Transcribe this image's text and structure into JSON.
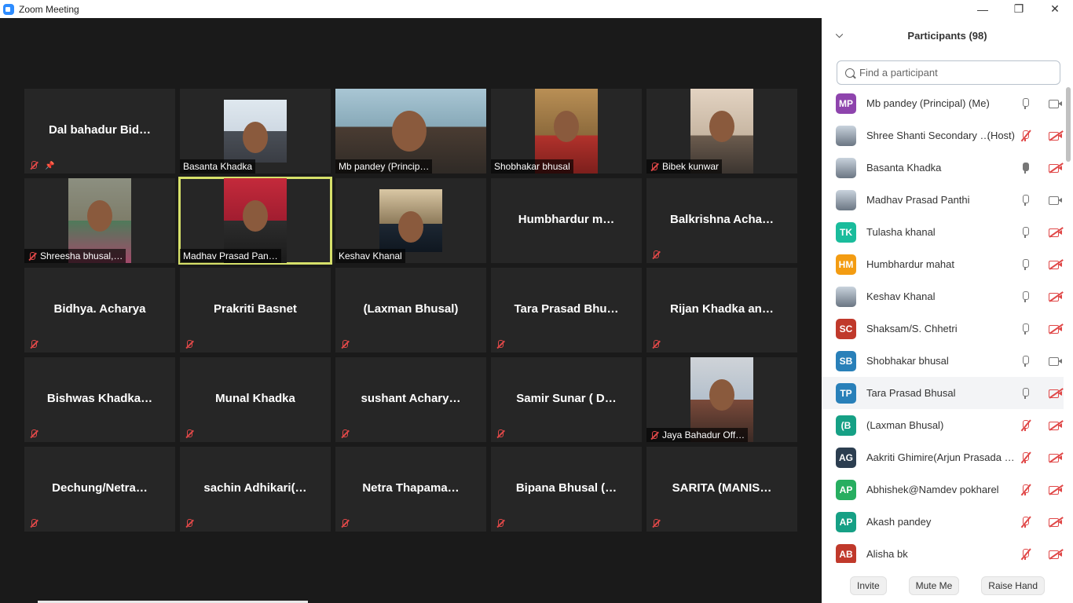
{
  "window": {
    "title": "Zoom Meeting",
    "minimize": "—",
    "restore": "❐",
    "close": "✕"
  },
  "tiles": [
    {
      "name": "Dal bahadur Bid…",
      "video": false,
      "muted": true,
      "pinned": true
    },
    {
      "name": "Basanta Khadka",
      "video": true,
      "photo": "ph-sky",
      "muted": false
    },
    {
      "name": "Mb pandey (Princip…",
      "video": true,
      "photo": "ph-room",
      "muted": false
    },
    {
      "name": "Shobhakar bhusal",
      "video": true,
      "photo": "ph-orange",
      "muted": false
    },
    {
      "name": "Bibek kunwar",
      "video": true,
      "photo": "ph-wall",
      "muted": true
    },
    {
      "name": "Shreesha bhusal,…",
      "video": true,
      "photo": "ph-family",
      "muted": true
    },
    {
      "name": "Madhav Prasad Pan…",
      "video": true,
      "photo": "ph-red",
      "muted": false,
      "active": true
    },
    {
      "name": "Keshav Khanal",
      "video": true,
      "photo": "ph-desk",
      "muted": false
    },
    {
      "name": "Humbhardur m…",
      "video": false,
      "muted": false
    },
    {
      "name": "Balkrishna Acha…",
      "video": false,
      "muted": true
    },
    {
      "name": "Bidhya. Acharya",
      "video": false,
      "muted": true
    },
    {
      "name": "Prakriti Basnet",
      "video": false,
      "muted": true
    },
    {
      "name": "(Laxman Bhusal)",
      "video": false,
      "muted": true
    },
    {
      "name": "Tara Prasad Bhu…",
      "video": false,
      "muted": true
    },
    {
      "name": "Rijan Khadka an…",
      "video": false,
      "muted": true
    },
    {
      "name": "Bishwas Khadka…",
      "video": false,
      "muted": true
    },
    {
      "name": "Munal Khadka",
      "video": false,
      "muted": true
    },
    {
      "name": "sushant Achary…",
      "video": false,
      "muted": true
    },
    {
      "name": "Samir Sunar ( D…",
      "video": false,
      "muted": true
    },
    {
      "name": "Jaya Bahadur Off…",
      "video": true,
      "photo": "ph-flag",
      "muted": true
    },
    {
      "name": "Dechung/Netra…",
      "video": false,
      "muted": true
    },
    {
      "name": "sachin Adhikari(…",
      "video": false,
      "muted": true
    },
    {
      "name": "Netra Thapama…",
      "video": false,
      "muted": true
    },
    {
      "name": "Bipana Bhusal (…",
      "video": false,
      "muted": true
    },
    {
      "name": "SARITA (MANIS…",
      "video": false,
      "muted": true
    }
  ],
  "participants": {
    "title": "Participants (98)",
    "search_placeholder": "Find a participant",
    "list": [
      {
        "initials": "MP",
        "color": "#8e44ad",
        "name": "Mb pandey (Principal) (Me)",
        "tag": "",
        "mic": "on",
        "cam": "on"
      },
      {
        "initials": "",
        "color": "",
        "photo": true,
        "name": "Shree Shanti Secondary …",
        "tag": "(Host)",
        "mic": "muted",
        "cam": "off"
      },
      {
        "initials": "",
        "color": "",
        "photo": true,
        "name": "Basanta Khadka",
        "tag": "",
        "mic": "speaking",
        "cam": "off"
      },
      {
        "initials": "",
        "color": "",
        "photo": true,
        "name": "Madhav Prasad Panthi",
        "tag": "",
        "mic": "on",
        "cam": "on"
      },
      {
        "initials": "TK",
        "color": "#1abc9c",
        "name": "Tulasha khanal",
        "tag": "",
        "mic": "on",
        "cam": "off"
      },
      {
        "initials": "HM",
        "color": "#f39c12",
        "name": "Humbhardur mahat",
        "tag": "",
        "mic": "on",
        "cam": "off"
      },
      {
        "initials": "",
        "color": "",
        "photo": true,
        "name": "Keshav Khanal",
        "tag": "",
        "mic": "on",
        "cam": "off"
      },
      {
        "initials": "SC",
        "color": "#c0392b",
        "name": "Shaksam/S. Chhetri",
        "tag": "",
        "mic": "on",
        "cam": "off"
      },
      {
        "initials": "SB",
        "color": "#2980b9",
        "name": "Shobhakar bhusal",
        "tag": "",
        "mic": "on",
        "cam": "on"
      },
      {
        "initials": "TP",
        "color": "#2980b9",
        "name": "Tara Prasad Bhusal",
        "tag": "",
        "mic": "on",
        "cam": "off",
        "hover": true
      },
      {
        "initials": "(B",
        "color": "#16a085",
        "name": "(Laxman Bhusal)",
        "tag": "",
        "mic": "muted",
        "cam": "off"
      },
      {
        "initials": "AG",
        "color": "#2c3e50",
        "name": "Aakriti Ghimire(Arjun Prasada G…",
        "tag": "",
        "mic": "muted",
        "cam": "off"
      },
      {
        "initials": "AP",
        "color": "#27ae60",
        "name": "Abhishek@Namdev pokharel",
        "tag": "",
        "mic": "muted",
        "cam": "off"
      },
      {
        "initials": "AP",
        "color": "#16a085",
        "name": "Akash pandey",
        "tag": "",
        "mic": "muted",
        "cam": "off"
      },
      {
        "initials": "AB",
        "color": "#c0392b",
        "name": "Alisha bk",
        "tag": "",
        "mic": "muted",
        "cam": "off"
      }
    ],
    "footer": {
      "invite": "Invite",
      "mute_me": "Mute Me",
      "raise_hand": "Raise Hand"
    }
  }
}
